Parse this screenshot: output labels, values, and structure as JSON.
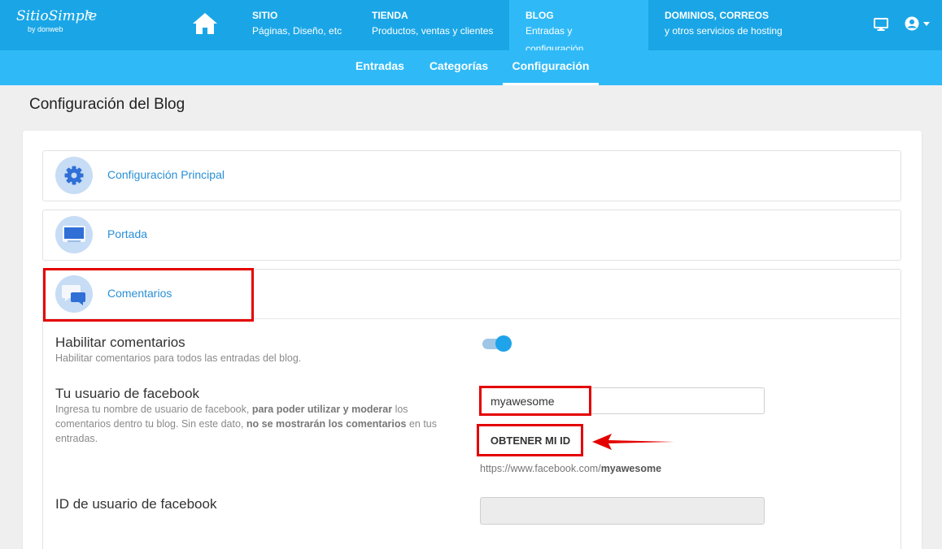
{
  "logo": {
    "line1": "SitioSimple",
    "line2": "by donweb"
  },
  "nav": {
    "items": [
      {
        "title": "SITIO",
        "subtitle": "Páginas, Diseño, etc"
      },
      {
        "title": "TIENDA",
        "subtitle": "Productos, ventas y clientes"
      },
      {
        "title": "BLOG",
        "subtitle": "Entradas y configuración"
      },
      {
        "title": "DOMINIOS, CORREOS",
        "subtitle": "y otros servicios de hosting"
      }
    ],
    "active": "BLOG"
  },
  "subnav": {
    "items": [
      "Entradas",
      "Categorías",
      "Configuración"
    ],
    "active": "Configuración"
  },
  "page_title": "Configuración del Blog",
  "panels": [
    {
      "label": "Configuración Principal",
      "icon": "gear-icon"
    },
    {
      "label": "Portada",
      "icon": "monitor-icon"
    },
    {
      "label": "Comentarios",
      "icon": "chat-bubbles-icon"
    }
  ],
  "comments": {
    "enable_title": "Habilitar comentarios",
    "enable_desc": "Habilitar comentarios para todos las entradas del blog.",
    "enabled": true,
    "fb_user_title": "Tu usuario de facebook",
    "fb_desc_1": "Ingresa tu nombre de usuario de facebook, ",
    "fb_desc_b1": "para poder utilizar y moderar",
    "fb_desc_2": " los comentarios dentro tu blog. Sin este dato, ",
    "fb_desc_b2": "no se mostrarán los comentarios",
    "fb_desc_3": " en tus entradas.",
    "fb_user_value": "myawesome",
    "get_id_button": "OBTENER MI ID",
    "fb_url_prefix": "https://www.facebook.com/",
    "fb_url_user": "myawesome",
    "fb_id_title": "ID de usuario de facebook",
    "fb_id_value": ""
  },
  "colors": {
    "topnav": "#1aa6e6",
    "subnav": "#2fbaf7",
    "link": "#2a8fd6",
    "highlight": "#e40000",
    "toggle_on": "#1fa3ea"
  }
}
